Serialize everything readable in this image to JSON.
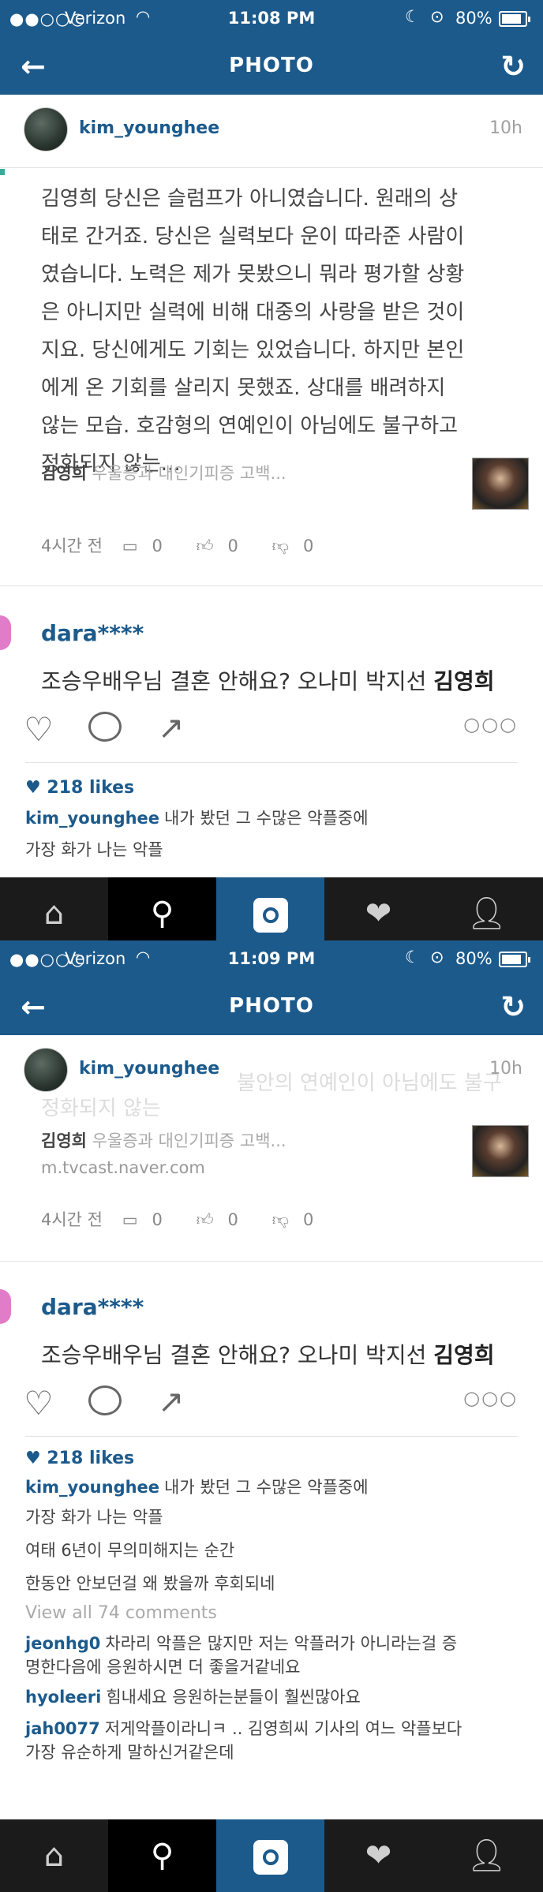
{
  "status1": {
    "carrier": "Verizon",
    "time": "11:08 PM",
    "battery": "80%"
  },
  "status2": {
    "carrier": "Verizon",
    "time": "11:09 PM",
    "battery": "80%"
  },
  "nav": {
    "title": "PHOTO"
  },
  "post": {
    "username": "kim_younghee",
    "time_ago": "10h",
    "article_lines": [
      "김영희 당신은 슬럼프가 아니였습니다. 원래의 상",
      "태로 간거죠. 당신은 실력보다 운이 따라준 사람이",
      "였습니다. 노력은 제가 못봤으니 뭐라 평가할 상황",
      "은 아니지만 실력에 비해 대중의 사랑을 받은 것이",
      "지요. 당신에게도 기회는 있었습니다. 하지만 본인",
      "에게 온 기회를 살리지 못했죠. 상대를 배려하지",
      "않는 모습. 호감형의 연예인이 아님에도 불구하고",
      "정화되지 않는..."
    ],
    "link_name": "김영희",
    "link_title": "우울증과 대인기피증 고백...",
    "link_url": "m.tvcast.naver.com",
    "meta_time": "4시간 전",
    "meta_comments": "0",
    "meta_likes": "0",
    "meta_dislikes": "0",
    "ghost_line1": "불안의 연예인이 아님에도 불구",
    "ghost_line2": "정화되지 않는"
  },
  "comment_post": {
    "user": "dara****",
    "text_plain": "조승우배우님 결혼 안해요? 오나미 박지선 ",
    "text_bold": "김영희"
  },
  "likes": "218 likes",
  "comments": [
    {
      "user": "kim_younghee",
      "text": "내가 봤던 그 수많은 악플중에"
    },
    {
      "user": "",
      "text": "가장 화가 나는 악플"
    },
    {
      "user": "",
      "text": "여태 6년이 무의미해지는 순간"
    },
    {
      "user": "",
      "text": "한동안 안보던걸 왜 봤을까 후회되네"
    }
  ],
  "view_all": "View all 74 comments",
  "replies": [
    {
      "user": "jeonhg0",
      "text": "차라리 악플은 많지만 저는 악플러가 아니라는걸 증",
      "text2": "명한다음에 응원하시면 더 좋을거같네요"
    },
    {
      "user": "hyoleeri",
      "text": "힘내세요 응원하는분들이 훨씬많아요",
      "text2": ""
    },
    {
      "user": "jah0077",
      "text": "저게악플이라니ㅋ .. 김영희씨 기사의 여느 악플보다",
      "text2": "가장 유순하게 말하신거같은데"
    }
  ],
  "icons": {
    "back": "back-arrow-icon",
    "refresh": "refresh-icon",
    "home": "home-icon",
    "search": "search-icon",
    "photo": "camera-icon",
    "activity": "heart-bubble-icon",
    "profile": "profile-icon"
  },
  "colors": {
    "brand": "#1c5a8c",
    "accent_pink": "#e07cc8"
  }
}
